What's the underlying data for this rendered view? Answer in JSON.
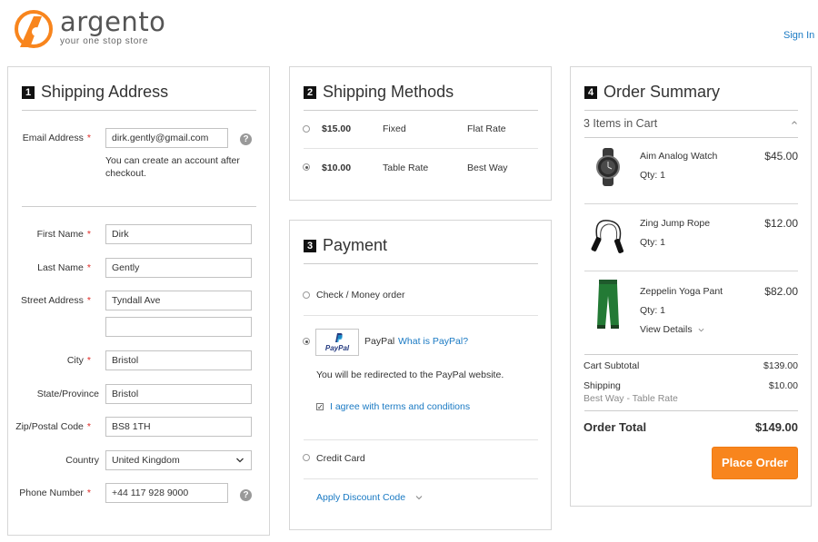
{
  "header": {
    "brand": "argento",
    "tagline": "your one stop store",
    "sign_in": "Sign In",
    "brand_color": "#f8851d"
  },
  "shipping_address": {
    "step": "1",
    "title": "Shipping Address",
    "email_label": "Email Address",
    "email_value": "dirk.gently@gmail.com",
    "email_note_1": "You can create an account after",
    "email_note_2": "checkout.",
    "help": "?",
    "first_name_label": "First Name",
    "first_name": "Dirk",
    "last_name_label": "Last Name",
    "last_name": "Gently",
    "street_label": "Street Address",
    "street_1": "Tyndall Ave",
    "street_2": "",
    "city_label": "City",
    "city": "Bristol",
    "state_label": "State/Province",
    "state": "Bristol",
    "zip_label": "Zip/Postal Code",
    "zip": "BS8 1TH",
    "country_label": "Country",
    "country": "United Kingdom",
    "phone_label": "Phone Number",
    "phone": "+44 117 928 9000",
    "required_mark": "*"
  },
  "shipping_methods": {
    "step": "2",
    "title": "Shipping Methods",
    "methods": [
      {
        "price": "$15.00",
        "method": "Fixed",
        "carrier": "Flat Rate",
        "selected": false
      },
      {
        "price": "$10.00",
        "method": "Table Rate",
        "carrier": "Best Way",
        "selected": true
      }
    ]
  },
  "payment": {
    "step": "3",
    "title": "Payment",
    "check_money": "Check / Money order",
    "paypal_label": "PayPal",
    "paypal_logo": "PayPal",
    "paypal_what": "What is PayPal?",
    "paypal_note": "You will be redirected to the PayPal website.",
    "agree_label": "I agree with terms and conditions",
    "agree_checked": true,
    "credit_card": "Credit Card",
    "discount": "Apply Discount Code",
    "selected": "paypal"
  },
  "order_summary": {
    "step": "4",
    "title": "Order Summary",
    "items_in_cart": "3 Items in Cart",
    "items": [
      {
        "name": "Aim Analog Watch",
        "qty": "Qty: 1",
        "price": "$45.00",
        "icon": "watch-icon"
      },
      {
        "name": "Zing Jump Rope",
        "qty": "Qty: 1",
        "price": "$12.00",
        "icon": "jump-rope-icon"
      },
      {
        "name": "Zeppelin Yoga Pant",
        "qty": "Qty: 1",
        "price": "$82.00",
        "icon": "yoga-pant-icon",
        "details": "View Details"
      }
    ],
    "subtotal_label": "Cart Subtotal",
    "subtotal": "$139.00",
    "shipping_label": "Shipping",
    "shipping_method": "Best Way - Table Rate",
    "shipping": "$10.00",
    "total_label": "Order Total",
    "total": "$149.00",
    "place_order": "Place Order"
  }
}
